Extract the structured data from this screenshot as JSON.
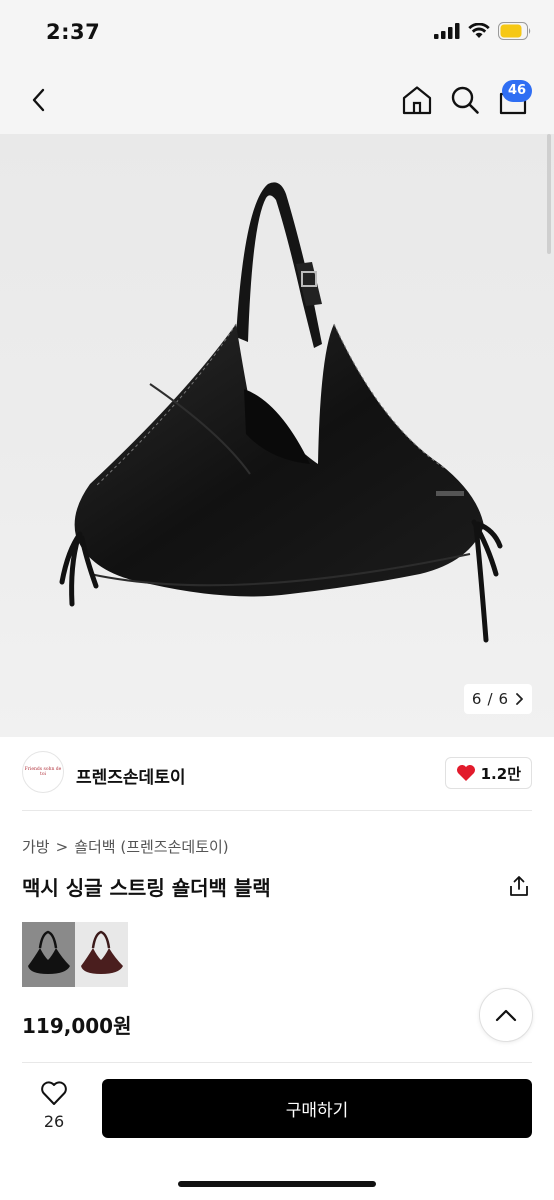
{
  "status": {
    "time": "2:37"
  },
  "nav": {
    "cart_count": "46"
  },
  "gallery": {
    "current": "6",
    "separator": "/",
    "total": "6"
  },
  "brand": {
    "logo_text": "Friends sohn de toi",
    "name": "프렌즈손데토이",
    "likes": "1.2만"
  },
  "breadcrumb": {
    "category": "가방",
    "separator": ">",
    "subcategory": "숄더백 (프렌즈손데토이)"
  },
  "product": {
    "title": "맥시 싱글 스트링 숄더백 블랙",
    "price": "119,000원"
  },
  "options": {
    "colors": [
      "black",
      "burgundy"
    ],
    "selected": "black"
  },
  "bottom": {
    "wish_count": "26",
    "buy_label": "구매하기"
  },
  "icons": [
    "back-icon",
    "home-icon",
    "search-icon",
    "cart-icon",
    "chevron-right-icon",
    "heart-icon",
    "share-icon",
    "chevron-up-icon",
    "heart-outline-icon"
  ],
  "colors": {
    "badge": "#2f6ef3",
    "like_heart": "#e21b2c",
    "buy_button": "#000000"
  }
}
